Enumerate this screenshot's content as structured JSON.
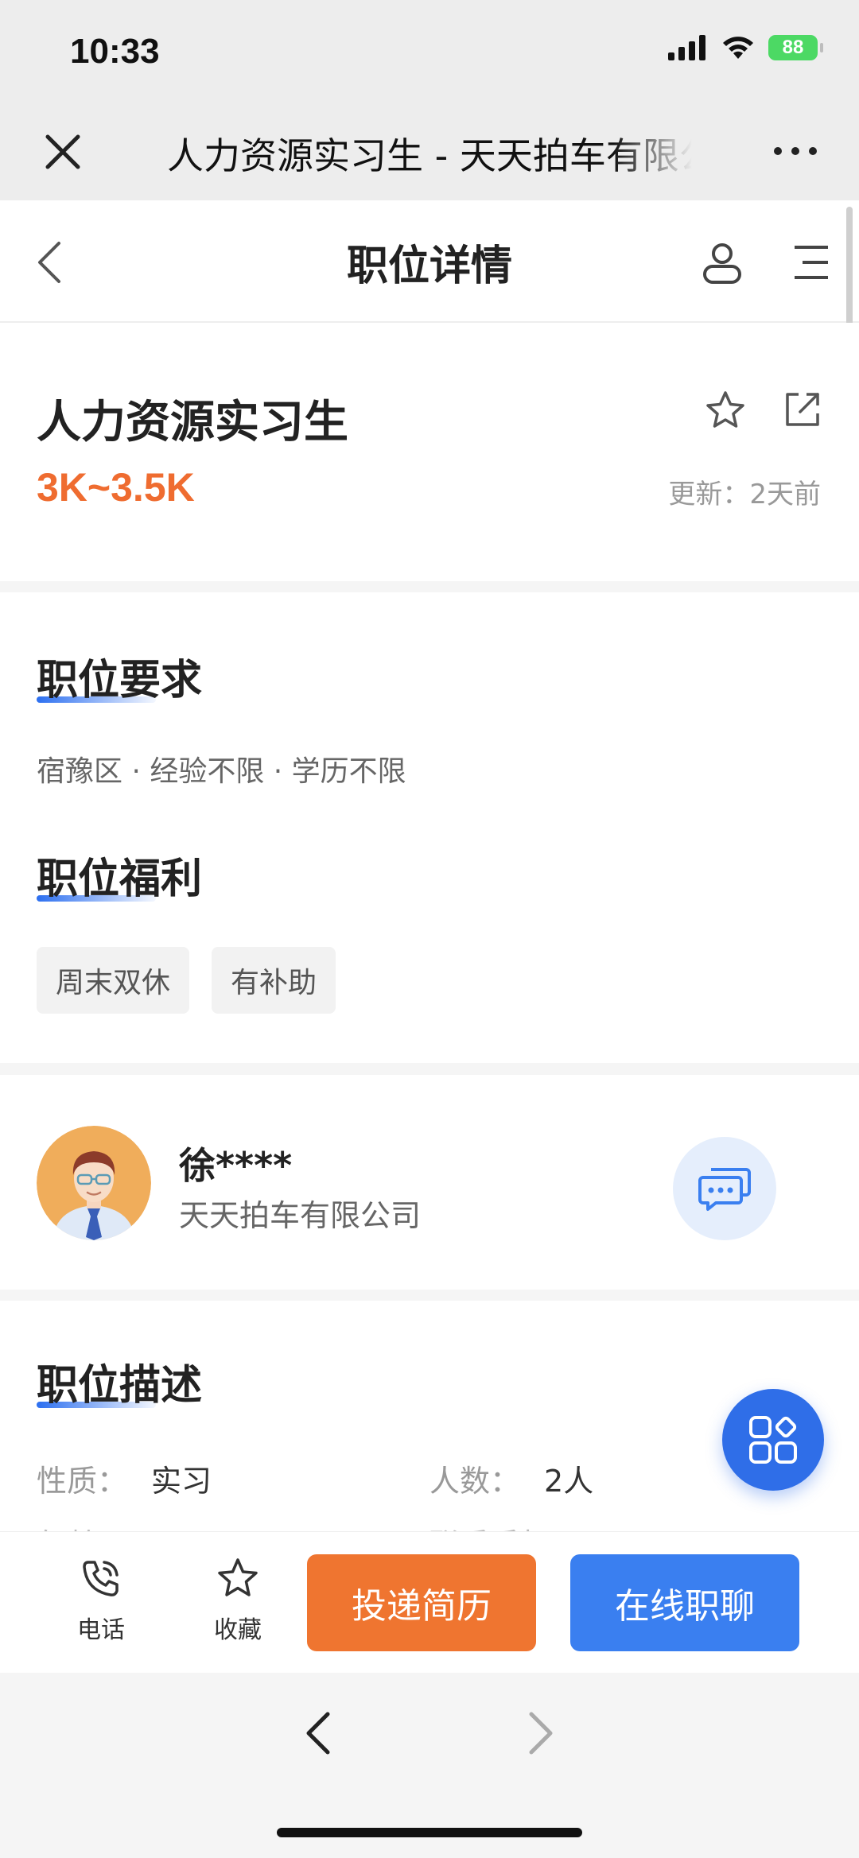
{
  "status_bar": {
    "time": "10:33",
    "battery": "88"
  },
  "wechat_bar": {
    "title": "人力资源实习生 - 天天拍车有限公司"
  },
  "nav": {
    "title": "职位详情"
  },
  "job": {
    "title": "人力资源实习生",
    "salary": "3K~3.5K",
    "update_label": "更新：",
    "update_value": "2天前"
  },
  "requirements": {
    "title": "职位要求",
    "text": "宿豫区 · 经验不限 · 学历不限"
  },
  "benefits": {
    "title": "职位福利",
    "tags": [
      "周末双休",
      "有补助"
    ]
  },
  "recruiter": {
    "name": "徐****",
    "company": "天天拍车有限公司"
  },
  "description": {
    "title": "职位描述",
    "nature_label": "性质：",
    "nature_value": "实习",
    "headcount_label": "人数：",
    "headcount_value": "2人",
    "cut_left": "年龄：",
    "cut_right": "联系手机："
  },
  "bottom": {
    "phone_label": "电话",
    "favorite_label": "收藏",
    "apply_label": "投递简历",
    "chat_label": "在线职聊"
  },
  "colors": {
    "accent_orange": "#ef6c30",
    "accent_blue": "#3a7ff0",
    "battery_green": "#4cd964"
  }
}
